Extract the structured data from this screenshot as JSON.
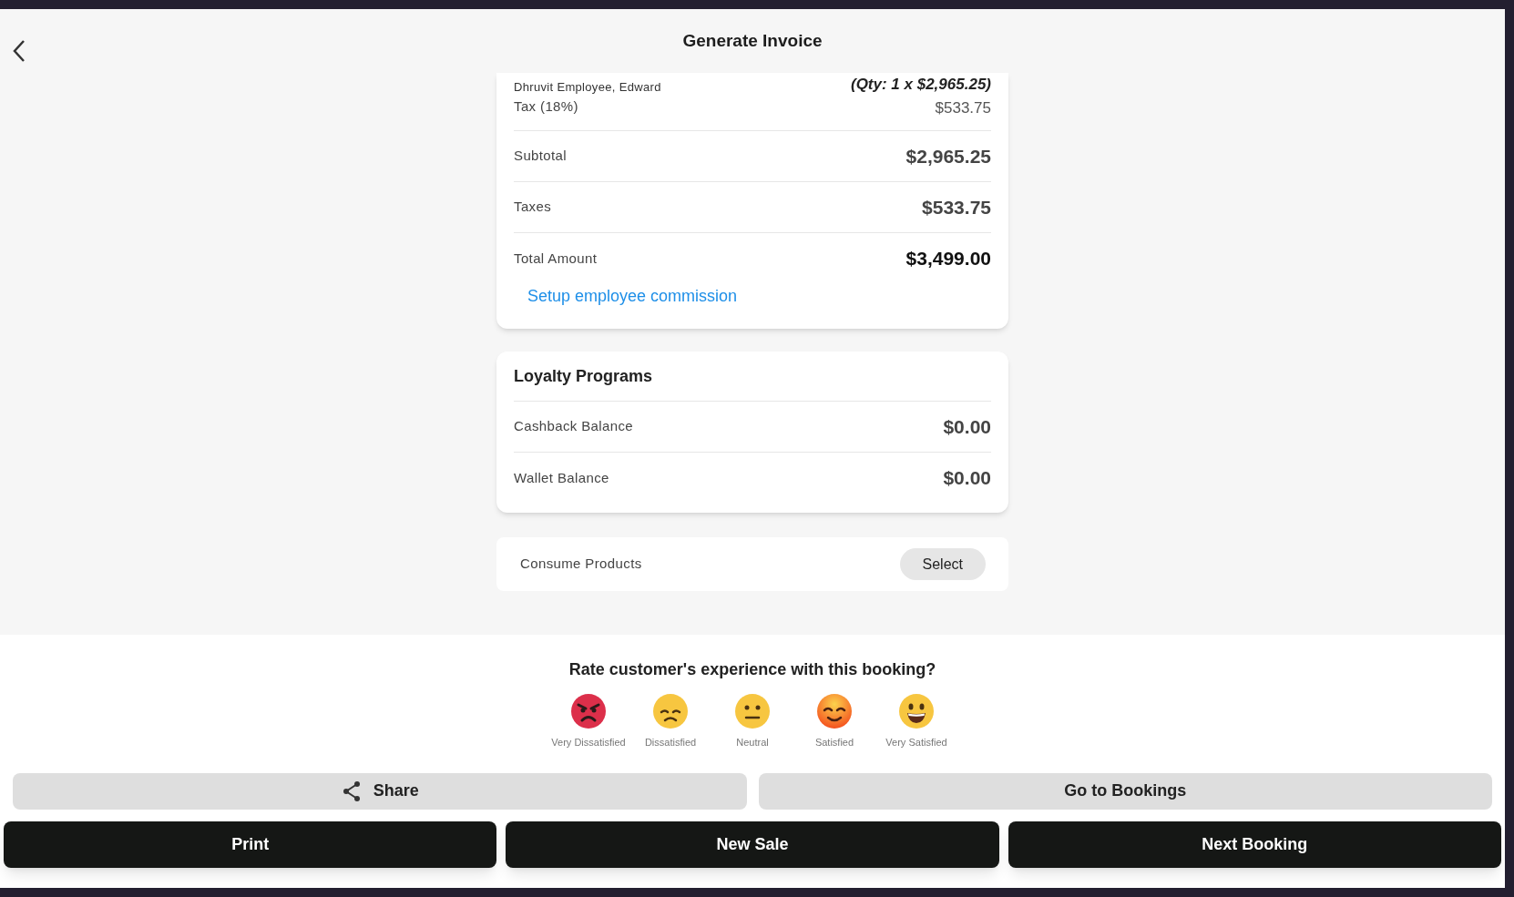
{
  "header": {
    "title": "Generate Invoice"
  },
  "invoice": {
    "employee": "Dhruvit Employee, Edward",
    "qty": "(Qty: 1 x $2,965.25)",
    "tax_label": "Tax (18%)",
    "tax_value": "$533.75",
    "totals": [
      {
        "label": "Subtotal",
        "value": "$2,965.25",
        "kind": "normal"
      },
      {
        "label": "Taxes",
        "value": "$533.75",
        "kind": "normal"
      },
      {
        "label": "Total Amount",
        "value": "$3,499.00",
        "kind": "grand"
      }
    ],
    "link": "Setup employee commission"
  },
  "loyalty": {
    "title": "Loyalty Programs",
    "rows": [
      {
        "label": "Cashback Balance",
        "value": "$0.00"
      },
      {
        "label": "Wallet Balance",
        "value": "$0.00"
      }
    ]
  },
  "consume": {
    "label": "Consume Products",
    "button": "Select"
  },
  "rating": {
    "question": "Rate customer's experience with this booking?",
    "options": [
      {
        "label": "Very Dissatisfied",
        "kind": "angry"
      },
      {
        "label": "Dissatisfied",
        "kind": "sad"
      },
      {
        "label": "Neutral",
        "kind": "neutral"
      },
      {
        "label": "Satisfied",
        "kind": "smiling"
      },
      {
        "label": "Very Satisfied",
        "kind": "grinning"
      }
    ]
  },
  "actions": {
    "secondary": [
      {
        "label": "Share",
        "kind": "share"
      },
      {
        "label": "Go to Bookings",
        "kind": "plain"
      }
    ],
    "primary": [
      "Print",
      "New Sale",
      "Next Booking"
    ]
  }
}
